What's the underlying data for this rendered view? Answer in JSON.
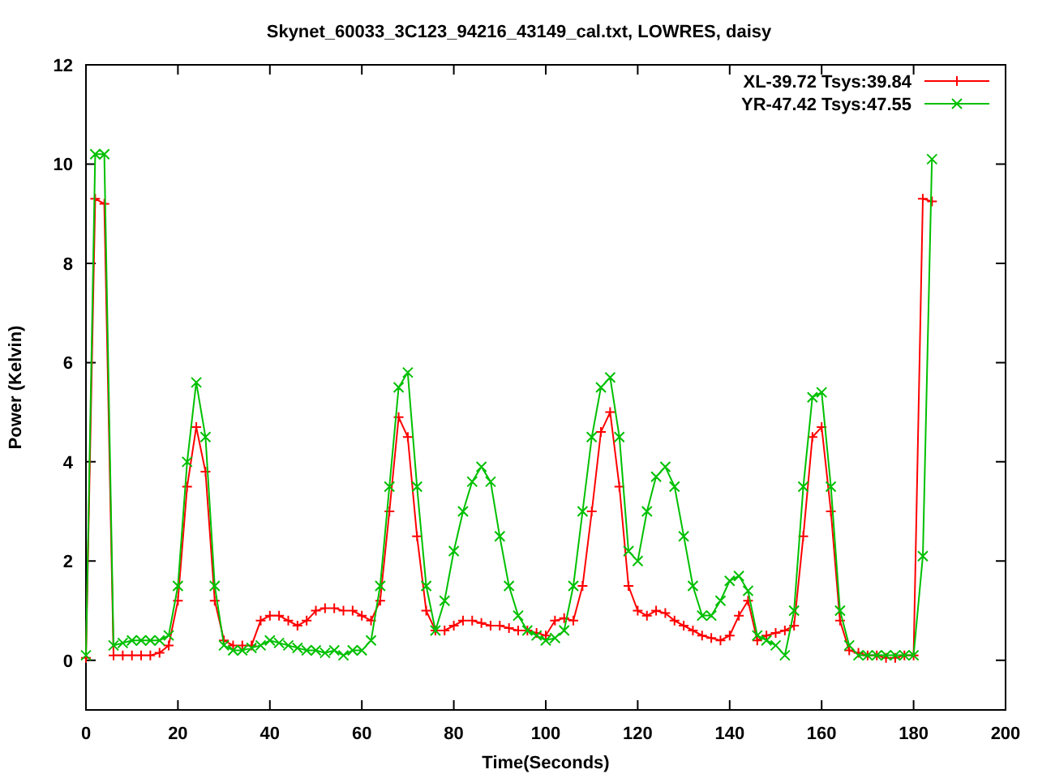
{
  "chart_data": {
    "type": "line",
    "title": "Skynet_60033_3C123_94216_43149_cal.txt, LOWRES, daisy",
    "xlabel": "Time(Seconds)",
    "ylabel": "Power (Kelvin)",
    "xlim": [
      0,
      200
    ],
    "ylim": [
      -1,
      12
    ],
    "xticks": [
      0,
      20,
      40,
      60,
      80,
      100,
      120,
      140,
      160,
      180,
      200
    ],
    "yticks": [
      0,
      2,
      4,
      6,
      8,
      10,
      12
    ],
    "legend": true,
    "x": [
      0,
      2,
      4,
      6,
      8,
      10,
      12,
      14,
      16,
      18,
      20,
      22,
      24,
      26,
      28,
      30,
      32,
      34,
      36,
      38,
      40,
      42,
      44,
      46,
      48,
      50,
      52,
      54,
      56,
      58,
      60,
      62,
      64,
      66,
      68,
      70,
      72,
      74,
      76,
      78,
      80,
      82,
      84,
      86,
      88,
      90,
      92,
      94,
      96,
      98,
      100,
      102,
      104,
      106,
      108,
      110,
      112,
      114,
      116,
      118,
      120,
      122,
      124,
      126,
      128,
      130,
      132,
      134,
      136,
      138,
      140,
      142,
      144,
      146,
      148,
      150,
      152,
      154,
      156,
      158,
      160,
      162,
      164,
      166,
      168,
      170,
      172,
      174,
      176,
      178,
      180,
      182,
      184
    ],
    "series": [
      {
        "name": "XL-39.72 Tsys:39.84",
        "color": "#ff0000",
        "marker": "plus",
        "values": [
          0.05,
          9.3,
          9.2,
          0.1,
          0.1,
          0.1,
          0.1,
          0.1,
          0.15,
          0.3,
          1.2,
          3.5,
          4.7,
          3.8,
          1.2,
          0.4,
          0.3,
          0.3,
          0.3,
          0.8,
          0.9,
          0.9,
          0.8,
          0.7,
          0.8,
          1.0,
          1.05,
          1.05,
          1.0,
          1.0,
          0.9,
          0.8,
          1.2,
          3,
          4.9,
          4.5,
          2.5,
          1.0,
          0.6,
          0.6,
          0.7,
          0.8,
          0.8,
          0.75,
          0.7,
          0.7,
          0.65,
          0.6,
          0.6,
          0.55,
          0.5,
          0.8,
          0.85,
          0.8,
          1.5,
          3,
          4.6,
          5.0,
          3.5,
          1.5,
          1.0,
          0.9,
          1.0,
          0.95,
          0.8,
          0.7,
          0.6,
          0.5,
          0.45,
          0.4,
          0.5,
          0.9,
          1.2,
          0.4,
          0.5,
          0.55,
          0.6,
          0.7,
          2.5,
          4.5,
          4.7,
          3,
          0.8,
          0.2,
          0.15,
          0.1,
          0.1,
          0.05,
          0.05,
          0.1,
          0.1,
          9.3,
          9.25
        ]
      },
      {
        "name": "YR-47.42 Tsys:47.55",
        "color": "#00c000",
        "marker": "cross",
        "values": [
          0.1,
          10.2,
          10.2,
          0.3,
          0.35,
          0.4,
          0.4,
          0.4,
          0.4,
          0.5,
          1.5,
          4,
          5.6,
          4.5,
          1.5,
          0.3,
          0.2,
          0.2,
          0.25,
          0.3,
          0.4,
          0.35,
          0.3,
          0.25,
          0.2,
          0.2,
          0.15,
          0.2,
          0.1,
          0.2,
          0.2,
          0.4,
          1.5,
          3.5,
          5.5,
          5.8,
          3.5,
          1.5,
          0.6,
          1.2,
          2.2,
          3,
          3.6,
          3.9,
          3.6,
          2.5,
          1.5,
          0.9,
          0.6,
          0.5,
          0.4,
          0.45,
          0.6,
          1.5,
          3,
          4.5,
          5.5,
          5.7,
          4.5,
          2.2,
          2.0,
          3,
          3.7,
          3.9,
          3.5,
          2.5,
          1.5,
          0.9,
          0.9,
          1.2,
          1.6,
          1.7,
          1.4,
          0.5,
          0.4,
          0.3,
          0.1,
          1,
          3.5,
          5.3,
          5.4,
          3.5,
          1,
          0.3,
          0.1,
          0.1,
          0.1,
          0.1,
          0.1,
          0.1,
          0.1,
          2.1,
          10.1
        ]
      }
    ]
  }
}
